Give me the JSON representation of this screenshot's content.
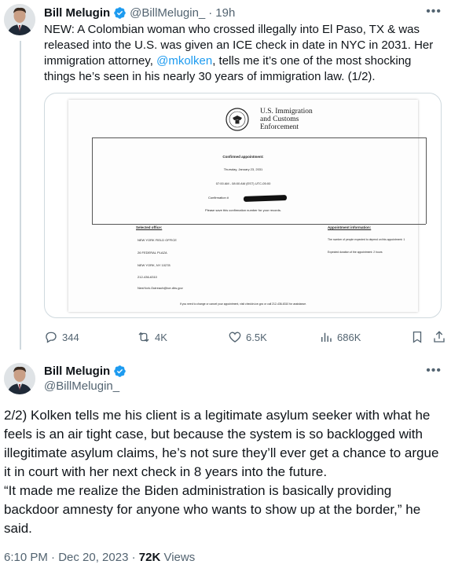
{
  "tweet1": {
    "author_name": "Bill Melugin",
    "handle": "@BillMelugin_",
    "time_sep": "·",
    "time": "19h",
    "text_before_mention": "NEW: A Colombian woman who crossed illegally into El Paso, TX & was released into the U.S. was given an ICE check in date in NYC in 2031. Her immigration attorney, ",
    "mention": "@mkolken",
    "text_after_mention": ", tells me it’s one of the most shocking things he’s seen in his nearly 30 years of immigration law. (1/2).",
    "more_icon": "more-horizontal-icon",
    "document": {
      "agency_line1": "U.S. Immigration",
      "agency_line2": "and Customs",
      "agency_line3": "Enforcement",
      "confirmed_heading": "Confirmed appointment:",
      "date_line": "Thursday, January 23, 2031",
      "time_line": "07:00 AM - 08:00 AM (EST) UTC-05:00",
      "confirmation_label": "Confirmation #",
      "save_note": "Please save this confirmation number for your records.",
      "selected_office_heading": "Selected office:",
      "office_lines": [
        "NEW YORK FIELD OFFICE",
        "26 FEDERAL PLAZA",
        "NEW YORK, NY 10278",
        "212-436-6310",
        "NewYork.Outreach@ice.dhs.gov"
      ],
      "appointment_info_heading": "Appointment information:",
      "info_lines": [
        "The number of people expected to depend on this appointment: 1",
        "Expected duration of the appointment: 2 hours"
      ],
      "footer_note": "If you need to change or cancel your appointment, visit checkin.ice.gov or call 212-436-6310 for assistance."
    },
    "actions": {
      "replies": "344",
      "reposts": "4K",
      "likes": "6.5K",
      "views": "686K"
    }
  },
  "tweet2": {
    "author_name": "Bill Melugin",
    "handle": "@BillMelugin_",
    "paragraph1": "2/2) Kolken tells me his client is a legitimate asylum seeker with what he feels is an air tight case, but because the system is so backlogged with illegitimate asylum claims, he’s not sure they’ll ever get a chance to argue it in court with her next check in 8 years into the future.",
    "paragraph2": "“It made me realize the Biden administration is basically providing backdoor amnesty for anyone who wants to show up at the border,” he said.",
    "timestamp": "6:10 PM · Dec 20, 2023 · ",
    "views_count": "72K",
    "views_label": " Views"
  },
  "colors": {
    "accent": "#1d9bf0",
    "text_secondary": "#536471",
    "thread_line": "#cfd9de"
  }
}
